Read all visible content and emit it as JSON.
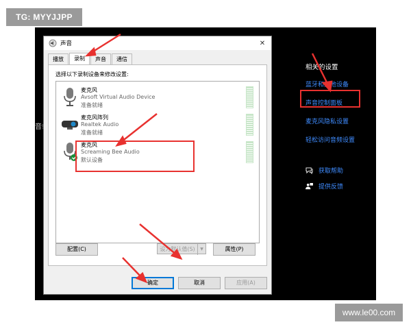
{
  "watermark_top": "TG: MYYJJPP",
  "watermark_bottom": "www.le00.com",
  "background": {
    "cut_text": "音!"
  },
  "settings_panel": {
    "title": "相关的设置",
    "links": [
      "蓝牙和其他设备",
      "声音控制面板",
      "麦克风隐私设置",
      "轻松访问音频设置"
    ],
    "help": [
      {
        "label": "获取帮助",
        "icon": "help-chat-icon"
      },
      {
        "label": "提供反馈",
        "icon": "feedback-person-icon"
      }
    ]
  },
  "dialog": {
    "title": "声音",
    "close_glyph": "✕",
    "tabs": [
      "播放",
      "录制",
      "声音",
      "通信"
    ],
    "active_tab": "录制",
    "instruction": "选择以下录制设备来修改设置:",
    "devices": [
      {
        "name": "麦克风",
        "description": "Avsoft Virtual Audio Device",
        "status": "准备就绪",
        "icon": "microphone-icon"
      },
      {
        "name": "麦克风阵列",
        "description": "Realtek Audio",
        "status": "准备就绪",
        "icon": "webcam-mic-array-icon"
      },
      {
        "name": "麦克风",
        "description": "Screaming Bee Audio",
        "status": "默认设备",
        "icon": "microphone-default-icon"
      }
    ],
    "buttons": {
      "configure": "配置(C)",
      "set_default": "设为默认值(S)",
      "properties": "属性(P)",
      "ok": "确定",
      "cancel": "取消",
      "apply": "应用(A)"
    }
  },
  "colors": {
    "highlight_red": "#e8312f",
    "link_blue": "#3f8cff",
    "accent": "#0078d7"
  }
}
